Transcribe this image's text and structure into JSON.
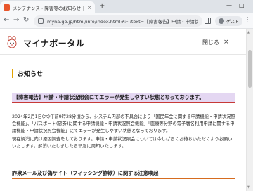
{
  "browser": {
    "tab": {
      "title": "メンテナンス・障害等のお知らせ｜マ",
      "close": "×"
    },
    "new_tab": "+",
    "window": {
      "minimize": "—",
      "maximize": "□"
    },
    "nav": {
      "back": "←",
      "forward": "→",
      "reload": "↻"
    },
    "url": "myna.go.jp/html/info/index.html#:~:text=【障害報告】申請・申請状況...",
    "profile": {
      "label": "ゲスト"
    },
    "menu": "⋮"
  },
  "site": {
    "logo_text": "マイナポータル",
    "close_menu_label": "閉じる",
    "close_menu_icon": "×"
  },
  "main": {
    "heading": "お知らせ",
    "notice1": {
      "title": "【障害報告】申請・申請状況照会にてエラーが発生しやすい状態となっております。",
      "paragraph1": "2024年2月1日(木)午前9時28分頃から、システム内部の不具合により「国民年金に関する申請機能・申請状況照会機能」、「パスポート(旅券)に関する申請機能・申請状況照会機能」「医療等分野の電子署名利用申請に関する申請機能・申請状況照会機能」にてエラーが発生しやすい状態となっております。",
      "paragraph2": "現在解消に向け原因調査をしております。申請・申請状況照会については今しばらくお待ちいただくようお願いいたします。解消いたしましたら早急に周知いたします。"
    },
    "notice2": {
      "title": "詐欺メール及び偽サイト（フィッシング詐欺）に関する注意喚起"
    }
  },
  "colors": {
    "accent_bar": "#e3a300",
    "notice_highlight": "#e4d7f2",
    "notice_underline": "#c73a38",
    "notice2_underline": "#d66c1f"
  }
}
